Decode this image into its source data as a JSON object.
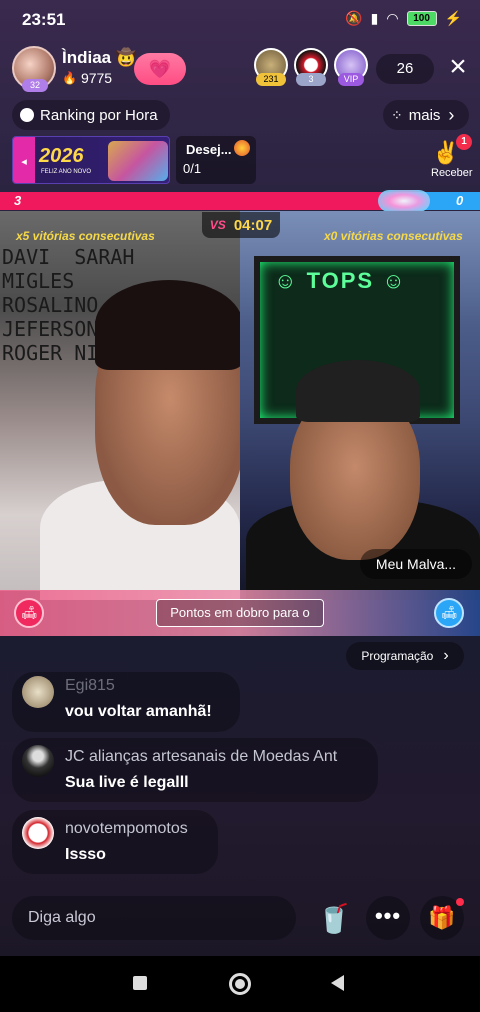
{
  "status_bar": {
    "time": "23:51",
    "battery": "100"
  },
  "host": {
    "name": "Ìndiaa 🤠",
    "likes": "9775",
    "level": "32",
    "follow_icon": "💗"
  },
  "viewers": [
    {
      "badge": "231",
      "color": "#f0c23a"
    },
    {
      "badge": "3",
      "color": "#9aa5c9"
    },
    {
      "badge": "VIP",
      "color": "#9b5ae0"
    }
  ],
  "viewer_count": "26",
  "close_label": "×",
  "ranking": {
    "label": "Ranking por Hora"
  },
  "more": {
    "label": "mais",
    "chevron": "›"
  },
  "banner": {
    "year": "2026",
    "subtitle": "FELIZ ANO NOVO",
    "arrow": "◂"
  },
  "desire": {
    "title": "Desej...",
    "count": "0/1"
  },
  "receber": {
    "label": "Receber",
    "badge": "1",
    "icon": "✌"
  },
  "pk": {
    "left_score": "3",
    "right_score": "0",
    "vs": "VS",
    "timer": "04:07"
  },
  "streamers": {
    "left_wins": "x5 vitórias consecutivas",
    "right_wins": "x0 vitórias consecutivas",
    "right_name": "Meu Malva...",
    "wall_text": "DAVI  SARAH\nMIGLES\nROSALINO\nJEFERSON\nROGER NIVA",
    "board_text": "☺ TOPS ☺"
  },
  "points_banner": "Pontos em dobro para o",
  "programacao": {
    "label": "Programação",
    "chevron": "›"
  },
  "chat": [
    {
      "name": "Egi815",
      "message": "vou voltar amanhã!"
    },
    {
      "name": "JC alianças artesanais de Moedas Ant",
      "message": "Sua live é legalll"
    },
    {
      "name": "novotempomotos",
      "message": "Issso"
    }
  ],
  "input": {
    "placeholder": "Diga algo"
  },
  "icons": {
    "cup": "🥤",
    "more": "•••",
    "gift": "🎁",
    "seat": "🛋",
    "likes": "🔥"
  }
}
